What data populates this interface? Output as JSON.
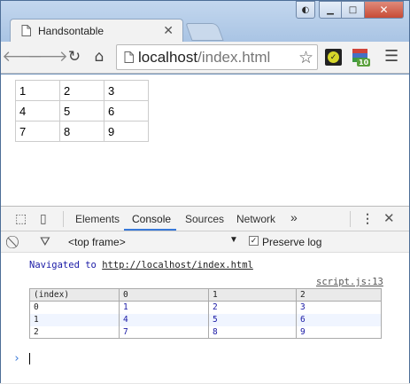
{
  "tab": {
    "title": "Handsontable"
  },
  "address": {
    "host": "localhost",
    "path": "/index.html"
  },
  "extensions": {
    "badge": "10"
  },
  "grid": [
    [
      "1",
      "2",
      "3"
    ],
    [
      "4",
      "5",
      "6"
    ],
    [
      "7",
      "8",
      "9"
    ]
  ],
  "devtools": {
    "tabs": [
      "Elements",
      "Console",
      "Sources",
      "Network"
    ],
    "active_tab": "Console",
    "more": "»",
    "context": "<top frame>",
    "preserve_log_label": "Preserve log",
    "preserve_log_checked": true
  },
  "console": {
    "navigated_prefix": "Navigated to ",
    "navigated_url": "http://localhost/index.html",
    "source": "script.js:13",
    "table_headers": [
      "(index)",
      "0",
      "1",
      "2"
    ],
    "table_rows": [
      [
        "0",
        "1",
        "2",
        "3"
      ],
      [
        "1",
        "4",
        "5",
        "6"
      ],
      [
        "2",
        "7",
        "8",
        "9"
      ]
    ],
    "prompt": "›"
  }
}
